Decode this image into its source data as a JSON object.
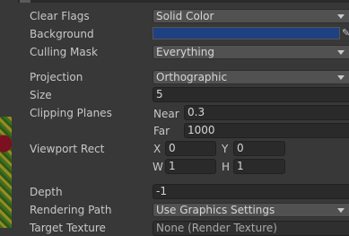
{
  "camera": {
    "clear_flags": {
      "label": "Clear Flags",
      "value": "Solid Color"
    },
    "background": {
      "label": "Background",
      "color": "#1f4181"
    },
    "culling_mask": {
      "label": "Culling Mask",
      "value": "Everything"
    },
    "projection": {
      "label": "Projection",
      "value": "Orthographic"
    },
    "size": {
      "label": "Size",
      "value": "5"
    },
    "clipping_planes": {
      "label": "Clipping Planes",
      "near_label": "Near",
      "near": "0.3",
      "far_label": "Far",
      "far": "1000"
    },
    "viewport_rect": {
      "label": "Viewport Rect",
      "x_label": "X",
      "x": "0",
      "y_label": "Y",
      "y": "0",
      "w_label": "W",
      "w": "1",
      "h_label": "H",
      "h": "1"
    },
    "depth": {
      "label": "Depth",
      "value": "-1"
    },
    "rendering_path": {
      "label": "Rendering Path",
      "value": "Use Graphics Settings"
    },
    "target_texture": {
      "label": "Target Texture",
      "value": "None (Render Texture)"
    }
  }
}
